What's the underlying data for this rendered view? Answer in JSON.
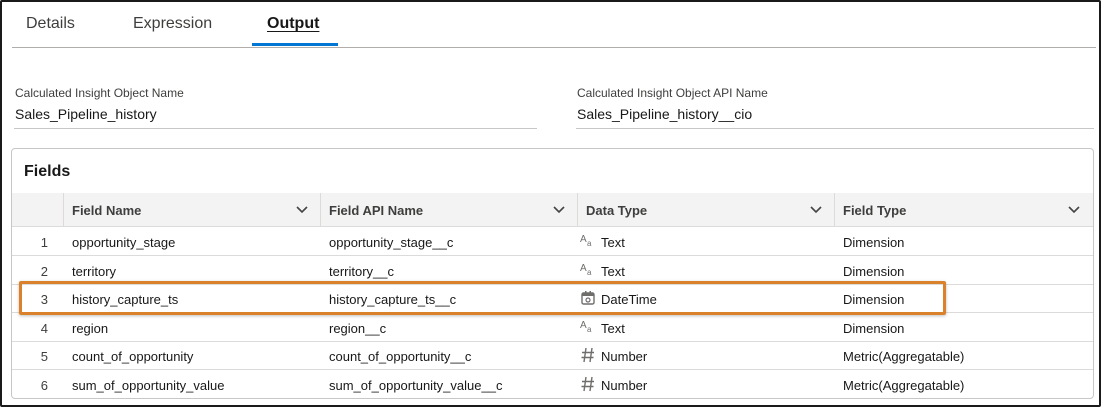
{
  "tabs": [
    {
      "label": "Details"
    },
    {
      "label": "Expression"
    },
    {
      "label": "Output"
    }
  ],
  "active_tab": "Output",
  "object_name": {
    "label": "Calculated Insight Object Name",
    "value": "Sales_Pipeline_history"
  },
  "api_name": {
    "label": "Calculated Insight Object API Name",
    "value": "Sales_Pipeline_history__cio"
  },
  "fields": {
    "title": "Fields",
    "columns": [
      "Field Name",
      "Field API Name",
      "Data Type",
      "Field Type"
    ],
    "rows": [
      {
        "num": "1",
        "name": "opportunity_stage",
        "api": "opportunity_stage__c",
        "type_icon": "text-type-icon",
        "type": "Text",
        "field_type": "Dimension"
      },
      {
        "num": "2",
        "name": "territory",
        "api": "territory__c",
        "type_icon": "text-type-icon",
        "type": "Text",
        "field_type": "Dimension"
      },
      {
        "num": "3",
        "name": "history_capture_ts",
        "api": "history_capture_ts__c",
        "type_icon": "calendar-icon",
        "type": "DateTime",
        "field_type": "Dimension"
      },
      {
        "num": "4",
        "name": "region",
        "api": "region__c",
        "type_icon": "text-type-icon",
        "type": "Text",
        "field_type": "Dimension"
      },
      {
        "num": "5",
        "name": "count_of_opportunity",
        "api": "count_of_opportunity__c",
        "type_icon": "number-icon",
        "type": "Number",
        "field_type": "Metric(Aggregatable)"
      },
      {
        "num": "6",
        "name": "sum_of_opportunity_value",
        "api": "sum_of_opportunity_value__c",
        "type_icon": "number-icon",
        "type": "Number",
        "field_type": "Metric(Aggregatable)"
      }
    ]
  },
  "colors": {
    "accent": "#0176d3",
    "highlight": "#d9822b"
  }
}
